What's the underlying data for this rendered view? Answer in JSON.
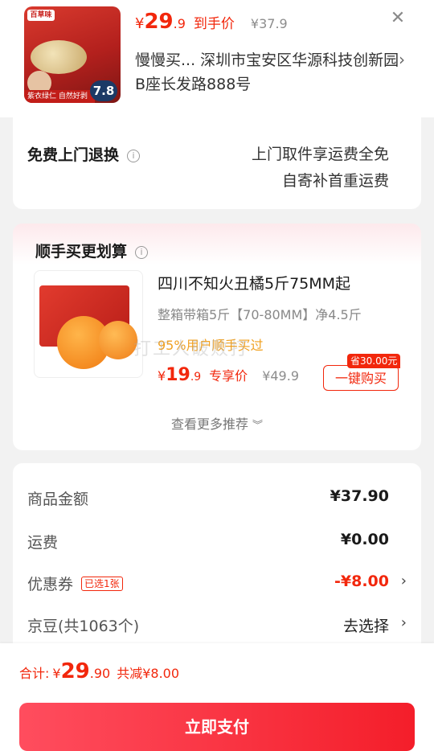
{
  "header": {
    "thumb": {
      "brand": "百草味",
      "strip_text": "紫衣绿仁 自然好剥",
      "badge_value": "7.8"
    },
    "price": {
      "currency": "¥",
      "integer": "29",
      "decimal": ".9",
      "tag": "到手价"
    },
    "original_price": "¥37.9",
    "address": "慢慢买...  深圳市宝安区华源科技创新园B座长发路888号",
    "close_icon": "close-icon"
  },
  "return_service": {
    "title": "免费上门退换",
    "desc_line1": "上门取件享运费全免",
    "desc_line2": "自寄补首重运费"
  },
  "recommend": {
    "title": "顺手买更划算",
    "product_name": "四川不知火丑橘5斤75MM起",
    "spec": "整箱带箱5斤【70-80MM】净4.5斤",
    "sold_text": "95%用户顺手买过",
    "watermark": "打工人破败打",
    "price": {
      "currency": "¥",
      "integer": "19",
      "decimal": ".9",
      "tag": "专享价"
    },
    "original_price": "¥49.9",
    "save_badge": "省30.00元",
    "buy_button": "一键购买",
    "more_link": "查看更多推荐"
  },
  "summary": {
    "goods_amount_label": "商品金额",
    "goods_amount_value": "¥37.90",
    "shipping_label": "运费",
    "shipping_value": "¥0.00",
    "coupon_label": "优惠券",
    "coupon_badge": "已选1张",
    "coupon_value": "-¥8.00",
    "jingdou_label": "京豆(共1063个)",
    "jingdou_value": "去选择"
  },
  "bottom": {
    "total_label": "合计:",
    "total_currency": "¥",
    "total_integer": "29",
    "total_decimal": ".90",
    "discount_text": "共减¥8.00",
    "pay_button": "立即支付"
  },
  "colors": {
    "accent_red": "#f2270c",
    "sold_orange": "#f0a020",
    "pay_gradient_start": "#ff4d5e",
    "pay_gradient_end": "#f41e2a"
  }
}
